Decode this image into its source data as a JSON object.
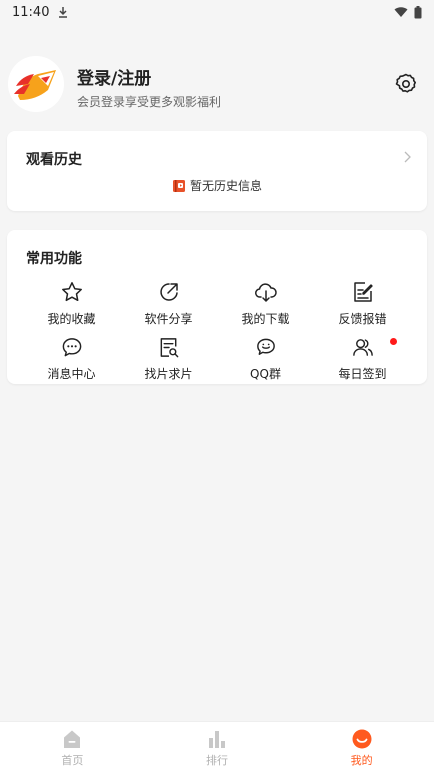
{
  "status_bar": {
    "time": "11:40",
    "icons": [
      "download-icon",
      "wifi-icon",
      "battery-icon"
    ]
  },
  "profile": {
    "title": "登录/注册",
    "subtitle": "会员登录享受更多观影福利",
    "settings_icon": "gear-icon"
  },
  "history": {
    "title": "观看历史",
    "empty_text": "暂无历史信息"
  },
  "functions": {
    "title": "常用功能",
    "items": [
      {
        "label": "我的收藏",
        "icon": "star-icon"
      },
      {
        "label": "软件分享",
        "icon": "share-icon"
      },
      {
        "label": "我的下载",
        "icon": "cloud-download-icon"
      },
      {
        "label": "反馈报错",
        "icon": "feedback-icon"
      },
      {
        "label": "消息中心",
        "icon": "message-icon"
      },
      {
        "label": "找片求片",
        "icon": "search-doc-icon"
      },
      {
        "label": "QQ群",
        "icon": "chat-bubbles-icon"
      },
      {
        "label": "每日签到",
        "icon": "users-icon",
        "badge": true
      }
    ]
  },
  "tabs": [
    {
      "label": "首页",
      "icon": "home-icon"
    },
    {
      "label": "排行",
      "icon": "bar-chart-icon"
    },
    {
      "label": "我的",
      "icon": "smile-icon",
      "active": true
    }
  ],
  "colors": {
    "accent": "#ff5a1f",
    "badge": "#ff1a1a",
    "background": "#f5f5f5"
  }
}
